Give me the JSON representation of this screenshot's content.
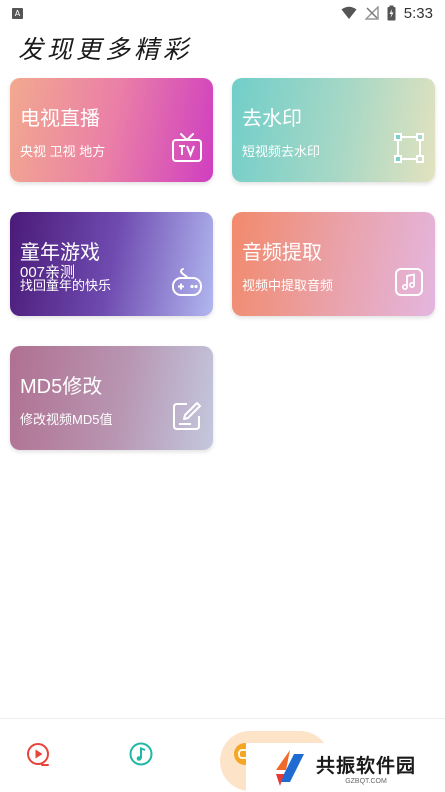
{
  "status_bar": {
    "notification_badge": "A",
    "time": "5:33",
    "icons": [
      "notification-a-icon",
      "wifi-icon",
      "no-signal-icon",
      "battery-charging-icon"
    ]
  },
  "page_title": "发现更多精彩",
  "cards": {
    "tv": {
      "title": "电视直播",
      "subtitle": "央视 卫视 地方",
      "icon": "tv-icon"
    },
    "watermark": {
      "title": "去水印",
      "subtitle": "短视频去水印",
      "icon": "crop-frame-icon"
    },
    "games": {
      "title": "童年游戏",
      "subtitle_line1": "007亲测",
      "subtitle_line2": "找回童年的快乐",
      "icon": "game-controller-icon"
    },
    "audio": {
      "title": "音频提取",
      "subtitle": "视频中提取音频",
      "icon": "music-note-icon"
    },
    "md5": {
      "title": "MD5修改",
      "subtitle": "修改视频MD5值",
      "icon": "edit-icon"
    }
  },
  "bottom_nav": {
    "items": [
      {
        "icon": "video-play-icon",
        "color": "#e8433a"
      },
      {
        "icon": "music-disc-icon",
        "color": "#1fb8a6"
      },
      {
        "icon": "game-icon",
        "color": "#f5a623",
        "active": true
      }
    ]
  },
  "watermark": {
    "brand": "共振软件园",
    "domain": "GZBQT.COM"
  }
}
